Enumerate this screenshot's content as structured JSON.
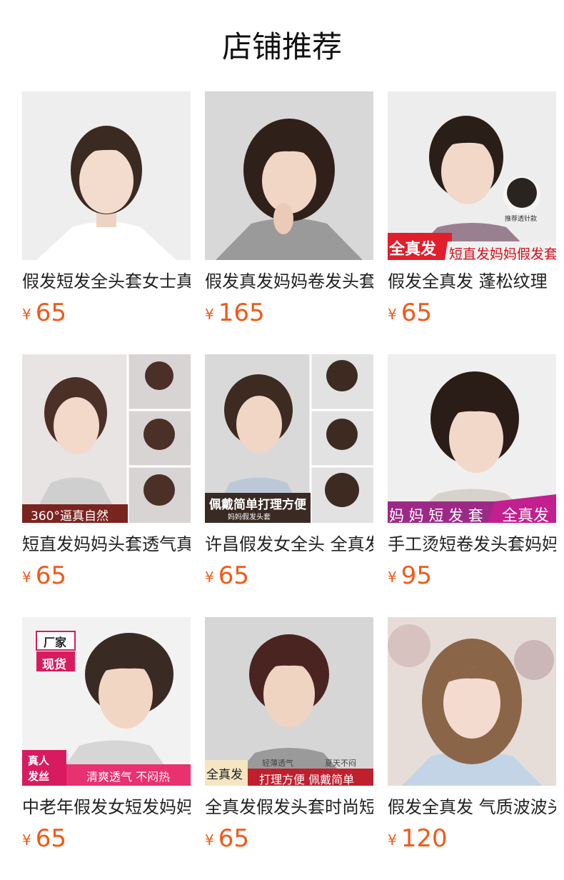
{
  "header": {
    "title": "店铺推荐"
  },
  "products": [
    {
      "name": "假发短发全头套女士真发",
      "currency": "¥",
      "price": "65",
      "bg": "#eeeeee",
      "hair": "#3b2a22",
      "top": "#ffffff",
      "badges": []
    },
    {
      "name": "假发真发妈妈卷发头套",
      "currency": "¥",
      "price": "165",
      "bg": "#d8d8d8",
      "hair": "#2f211a",
      "top": "#9a9a9a",
      "badges": []
    },
    {
      "name": "假发全真发 蓬松纹理",
      "currency": "¥",
      "price": "65",
      "bg": "#ededed",
      "hair": "#2a1f18",
      "top": "#9a7f90",
      "badges": [
        "全真发",
        "短直发妈妈假发套",
        "推荐透针款"
      ]
    },
    {
      "name": "短直发妈妈头套透气真发",
      "currency": "¥",
      "price": "65",
      "bg": "#e8e4e4",
      "hair": "#4a3026",
      "top": "#cfcfcf",
      "badges": [
        "360°逼真自然"
      ]
    },
    {
      "name": "许昌假发女全头 全真发",
      "currency": "¥",
      "price": "65",
      "bg": "#d9d9d9",
      "hair": "#3d2b22",
      "top": "#bcc8d8",
      "badges": [
        "佩戴简单打理方便",
        "妈妈假发头套"
      ]
    },
    {
      "name": "手工烫短卷发头套妈妈",
      "currency": "¥",
      "price": "95",
      "bg": "#efefef",
      "hair": "#2a1c16",
      "top": "#d8d2cc",
      "badges": [
        "妈 妈 短 发 套",
        "全真发"
      ]
    },
    {
      "name": "中老年假发女短发妈妈",
      "currency": "¥",
      "price": "65",
      "bg": "#f2f2f2",
      "hair": "#3a2a24",
      "top": "#d6d6d6",
      "badges": [
        "厂家",
        "现货",
        "真人",
        "发丝",
        "清爽透气 不闷热"
      ]
    },
    {
      "name": "全真发假发头套时尚短发",
      "currency": "¥",
      "price": "65",
      "bg": "#d6d6d6",
      "hair": "#4a2420",
      "top": "#9a9a9a",
      "badges": [
        "全真发",
        "轻薄透气",
        "夏天不闷",
        "打理方便 佩戴简单"
      ]
    },
    {
      "name": "假发全真发 气质波波头",
      "currency": "¥",
      "price": "120",
      "bg": "#e7ddd8",
      "hair": "#8a6548",
      "top": "#c3d4e6",
      "badges": []
    }
  ]
}
